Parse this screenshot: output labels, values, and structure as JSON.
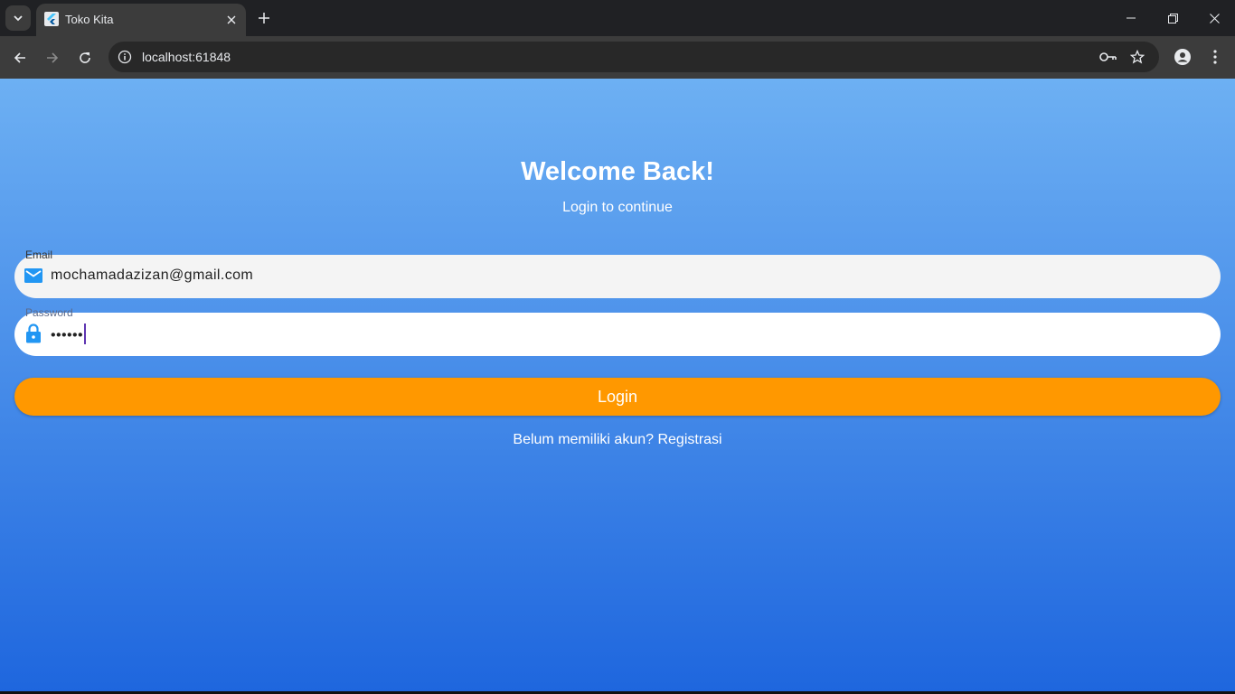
{
  "browser": {
    "tab_title": "Toko Kita",
    "url": "localhost:61848"
  },
  "page": {
    "heading": "Welcome Back!",
    "subheading": "Login to continue",
    "email": {
      "label": "Email",
      "value": "mochamadazizan@gmail.com"
    },
    "password": {
      "label": "Password",
      "value": "••••••"
    },
    "login_label": "Login",
    "register_label": "Belum memiliki akun? Registrasi"
  },
  "colors": {
    "gradient_top": "#6db0f3",
    "gradient_bottom": "#1e66de",
    "button": "#ff9800",
    "icon_blue": "#2196f3"
  }
}
